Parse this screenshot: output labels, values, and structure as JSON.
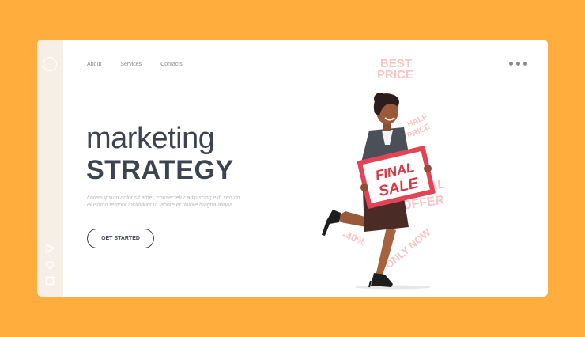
{
  "nav": {
    "items": [
      "About",
      "Services",
      "Contacts"
    ]
  },
  "hero": {
    "title_line1": "marketing",
    "title_line2": "STRATEGY",
    "body": "Lorem ipsum dolor sit amet, consectetur adipiscing elit, sed do eiusmod tempor incididunt ut labore et dolore magna aliqua",
    "cta_label": "GET STARTED"
  },
  "illustration": {
    "sign_line1": "FINAL",
    "sign_line2": "SALE",
    "bg_words": [
      "BEST",
      "PRICE",
      "HALF",
      "PRICE",
      "SPECIAL",
      "OFFER",
      "-40%",
      "ONLY NOW"
    ]
  },
  "icons": [
    "menu-circle-icon",
    "play-icon",
    "heart-icon",
    "square-icon",
    "more-dots-icon"
  ],
  "colors": {
    "background": "#ffae3d",
    "card": "#ffffff",
    "sidebar": "#f7eee6",
    "text_dark": "#3d4451",
    "sale_red": "#d33a48"
  }
}
